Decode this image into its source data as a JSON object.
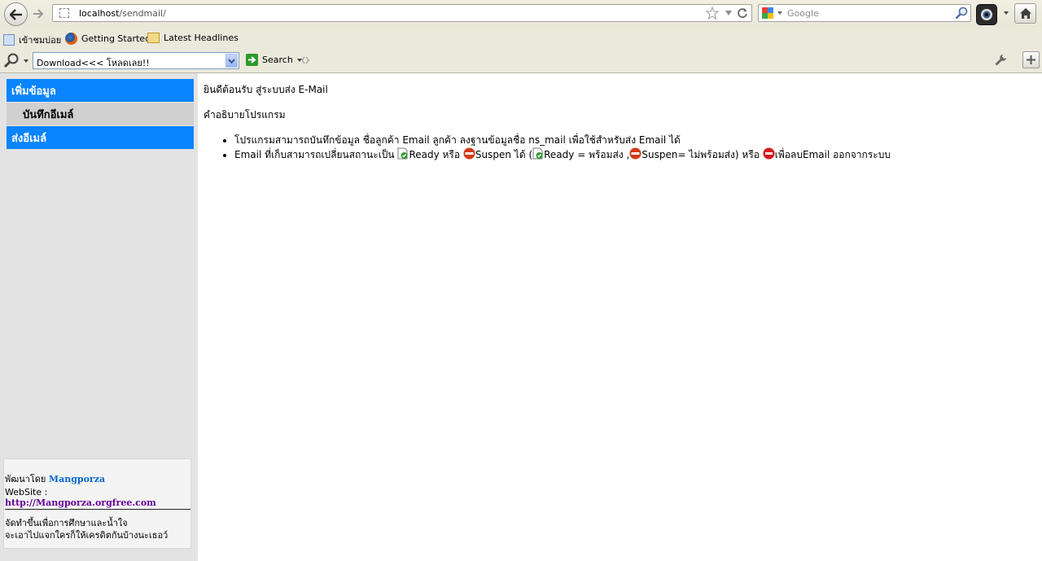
{
  "browser": {
    "url_host": "localhost",
    "url_path": "/sendmail/",
    "search_placeholder": "Google",
    "bookmarks": [
      {
        "label": "เข้าชมบ่อย"
      },
      {
        "label": "Getting Started"
      },
      {
        "label": "Latest Headlines"
      }
    ],
    "toolbar": {
      "dropdown_value": "Download<<<  โหลดเลย!!",
      "search_label": "Search"
    }
  },
  "sidebar": {
    "items": [
      {
        "label": "เพิ่มข้อมูล"
      },
      {
        "label": "บันทึกอีเมล์"
      },
      {
        "label": "ส่งอีเมล์"
      }
    ],
    "footer": {
      "dev_prefix": "พัฒนาโดย",
      "dev_name": "Mangporza",
      "website_prefix": "WebSite :",
      "website_url": "http://Mangporza.orgfree.com",
      "note_line1": "จัดทำขึ้นเพื่อการศึกษาและน้ำใจ",
      "note_line2": "จะเอาไปแจกใครก็ให้เครดิตกันบ้างนะเธอว์"
    }
  },
  "main": {
    "welcome": "ยินดีต้อนรับ สู่ระบบส่ง E-Mail",
    "description_title": "คำอธิบายโปรแกรม",
    "bullet1": "โปรแกรมสามารถบันทึกข้อมูล ชื่อลูกค้า Email ลูกค้า ลงฐานข้อมูลชื่อ ns_mail เพื่อใช้สำหรับส่ง Email ได้",
    "bullet2": {
      "t1": "Email ที่เก็บสามารถเปลี่ยนสถานะเป็น ",
      "t2": "Ready หรือ ",
      "t3": "Suspen ได้ (",
      "t4": "Ready = พร้อมส่ง ,",
      "t5": "Suspen= ไม่พร้อมส่ง) หรือ ",
      "t6": "เพื่อลบEmail ออกจากระบบ"
    }
  },
  "colors": {
    "menu_blue": "#0a84ff",
    "link_blue": "#0066cc",
    "link_purple": "#660099"
  }
}
